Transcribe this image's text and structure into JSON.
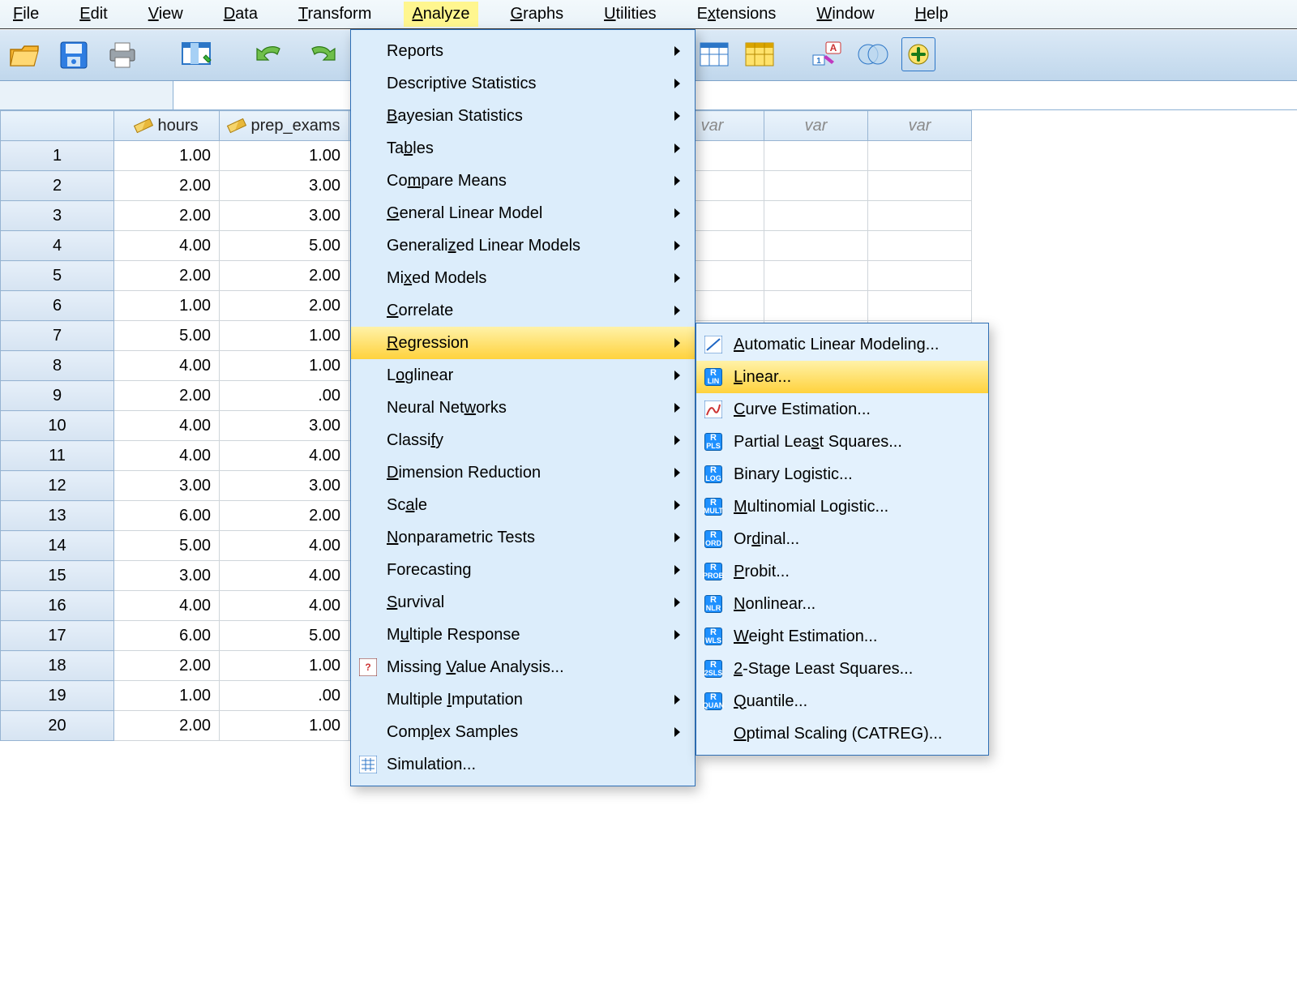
{
  "menubar": {
    "items": [
      {
        "label": "File",
        "m": "F"
      },
      {
        "label": "Edit",
        "m": "E"
      },
      {
        "label": "View",
        "m": "V"
      },
      {
        "label": "Data",
        "m": "D"
      },
      {
        "label": "Transform",
        "m": "T"
      },
      {
        "label": "Analyze",
        "m": "A",
        "active": true
      },
      {
        "label": "Graphs",
        "m": "G"
      },
      {
        "label": "Utilities",
        "m": "U"
      },
      {
        "label": "Extensions",
        "m": "x"
      },
      {
        "label": "Window",
        "m": "W"
      },
      {
        "label": "Help",
        "m": "H"
      }
    ]
  },
  "columns": {
    "named": [
      "hours",
      "prep_exams"
    ],
    "var_label": "var",
    "extra_var_cols": 6
  },
  "rows": [
    {
      "n": 1,
      "hours": "1.00",
      "prep": "1.00"
    },
    {
      "n": 2,
      "hours": "2.00",
      "prep": "3.00"
    },
    {
      "n": 3,
      "hours": "2.00",
      "prep": "3.00"
    },
    {
      "n": 4,
      "hours": "4.00",
      "prep": "5.00"
    },
    {
      "n": 5,
      "hours": "2.00",
      "prep": "2.00"
    },
    {
      "n": 6,
      "hours": "1.00",
      "prep": "2.00"
    },
    {
      "n": 7,
      "hours": "5.00",
      "prep": "1.00"
    },
    {
      "n": 8,
      "hours": "4.00",
      "prep": "1.00"
    },
    {
      "n": 9,
      "hours": "2.00",
      "prep": ".00"
    },
    {
      "n": 10,
      "hours": "4.00",
      "prep": "3.00"
    },
    {
      "n": 11,
      "hours": "4.00",
      "prep": "4.00"
    },
    {
      "n": 12,
      "hours": "3.00",
      "prep": "3.00"
    },
    {
      "n": 13,
      "hours": "6.00",
      "prep": "2.00"
    },
    {
      "n": 14,
      "hours": "5.00",
      "prep": "4.00"
    },
    {
      "n": 15,
      "hours": "3.00",
      "prep": "4.00"
    },
    {
      "n": 16,
      "hours": "4.00",
      "prep": "4.00"
    },
    {
      "n": 17,
      "hours": "6.00",
      "prep": "5.00"
    },
    {
      "n": 18,
      "hours": "2.00",
      "prep": "1.00"
    },
    {
      "n": 19,
      "hours": "1.00",
      "prep": ".00"
    },
    {
      "n": 20,
      "hours": "2.00",
      "prep": "1.00"
    }
  ],
  "analyze_menu": [
    {
      "label": "Reports",
      "m": "P",
      "sub": true
    },
    {
      "label": "Descriptive Statistics",
      "m": "E",
      "sub": true
    },
    {
      "label": "Bayesian Statistics",
      "m": "B",
      "sub": true
    },
    {
      "label": "Tables",
      "m": "b",
      "sub": true
    },
    {
      "label": "Compare Means",
      "m": "m",
      "sub": true
    },
    {
      "label": "General Linear Model",
      "m": "G",
      "sub": true
    },
    {
      "label": "Generalized Linear Models",
      "m": "z",
      "sub": true
    },
    {
      "label": "Mixed Models",
      "m": "x",
      "sub": true
    },
    {
      "label": "Correlate",
      "m": "C",
      "sub": true
    },
    {
      "label": "Regression",
      "m": "R",
      "sub": true,
      "highlight": true
    },
    {
      "label": "Loglinear",
      "m": "o",
      "sub": true
    },
    {
      "label": "Neural Networks",
      "m": "w",
      "sub": true
    },
    {
      "label": "Classify",
      "m": "f",
      "sub": true
    },
    {
      "label": "Dimension Reduction",
      "m": "D",
      "sub": true
    },
    {
      "label": "Scale",
      "m": "a",
      "sub": true
    },
    {
      "label": "Nonparametric Tests",
      "m": "N",
      "sub": true
    },
    {
      "label": "Forecasting",
      "m": "T",
      "sub": true
    },
    {
      "label": "Survival",
      "m": "S",
      "sub": true
    },
    {
      "label": "Multiple Response",
      "m": "u",
      "sub": true
    },
    {
      "label": "Missing Value Analysis...",
      "m": "V",
      "sub": false,
      "icon": "mva"
    },
    {
      "label": "Multiple Imputation",
      "m": "I",
      "sub": true
    },
    {
      "label": "Complex Samples",
      "m": "l",
      "sub": true
    },
    {
      "label": "Simulation...",
      "m": "",
      "sub": false,
      "icon": "sim"
    }
  ],
  "regression_submenu": [
    {
      "label": "Automatic Linear Modeling...",
      "m": "A",
      "icon": "alm"
    },
    {
      "label": "Linear...",
      "m": "L",
      "icon": "lin",
      "highlight": true
    },
    {
      "label": "Curve Estimation...",
      "m": "C",
      "icon": "curve"
    },
    {
      "label": "Partial Least Squares...",
      "m": "s",
      "icon": "pls"
    },
    {
      "label": "Binary Logistic...",
      "m": "G",
      "icon": "log"
    },
    {
      "label": "Multinomial Logistic...",
      "m": "M",
      "icon": "mult"
    },
    {
      "label": "Ordinal...",
      "m": "d",
      "icon": "ord"
    },
    {
      "label": "Probit...",
      "m": "P",
      "icon": "prob"
    },
    {
      "label": "Nonlinear...",
      "m": "N",
      "icon": "nlr"
    },
    {
      "label": "Weight Estimation...",
      "m": "W",
      "icon": "wls"
    },
    {
      "label": "2-Stage Least Squares...",
      "m": "2",
      "icon": "2sls"
    },
    {
      "label": "Quantile...",
      "m": "Q",
      "icon": "quan"
    },
    {
      "label": "Optimal Scaling (CATREG)...",
      "m": "O",
      "icon": ""
    }
  ],
  "icon_sub": {
    "lin": "LIN",
    "pls": "PLS",
    "log": "LOG",
    "mult": "MULT",
    "ord": "ORD",
    "prob": "PROB",
    "nlr": "NLR",
    "wls": "WLS",
    "2sls": "2SLS",
    "quan": "QUAN"
  }
}
